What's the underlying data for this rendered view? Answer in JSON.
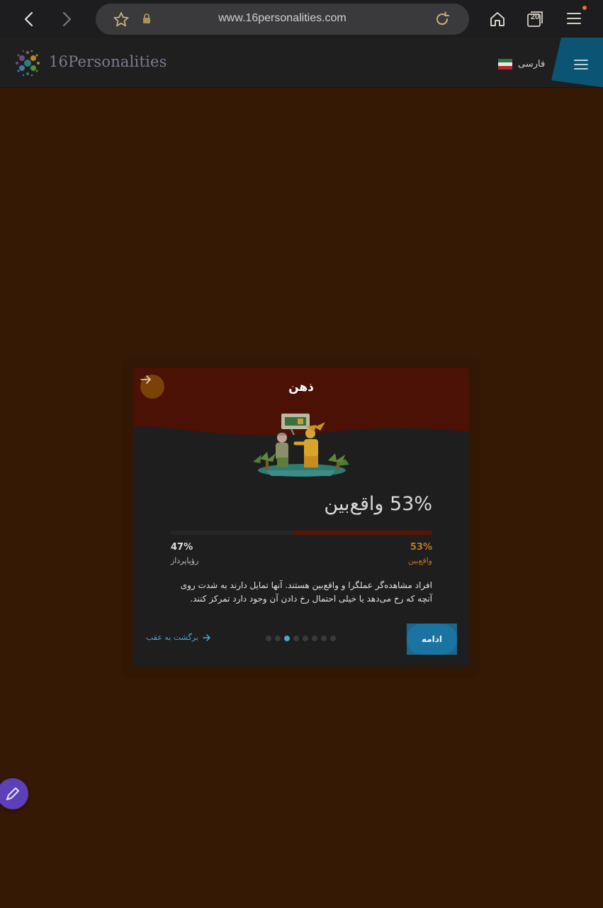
{
  "browser": {
    "url": "www.16personalities.com",
    "tab_count": "20",
    "icons": [
      "back-icon",
      "forward-icon",
      "star-icon",
      "lock-icon",
      "reload-icon",
      "home-icon",
      "tabs-icon",
      "menu-icon"
    ]
  },
  "header": {
    "brand": "16Personalities",
    "language": "فارسی"
  },
  "card": {
    "title": "ذهن",
    "headline": "53% واقع‌بین",
    "progress_right_pct": 53,
    "left": {
      "percent": "47%",
      "label": "رؤیاپرداز"
    },
    "right": {
      "percent": "53%",
      "label": "واقع‌بین"
    },
    "description": "افراد مشاهده‌گر عملگرا و واقع‌بین هستند. آنها تمایل دارند به شدت روی آنچه که رخ می‌دهد یا خیلی احتمال رخ دادن آن وجود دارد تمرکز کنند.",
    "continue_label": "ادامه",
    "back_label": "برگشت به عقب",
    "pagination": {
      "total": 8,
      "active_index": 2
    }
  },
  "colors": {
    "background": "#361905",
    "accent": "#1a73a0",
    "realist": "#b87920"
  }
}
